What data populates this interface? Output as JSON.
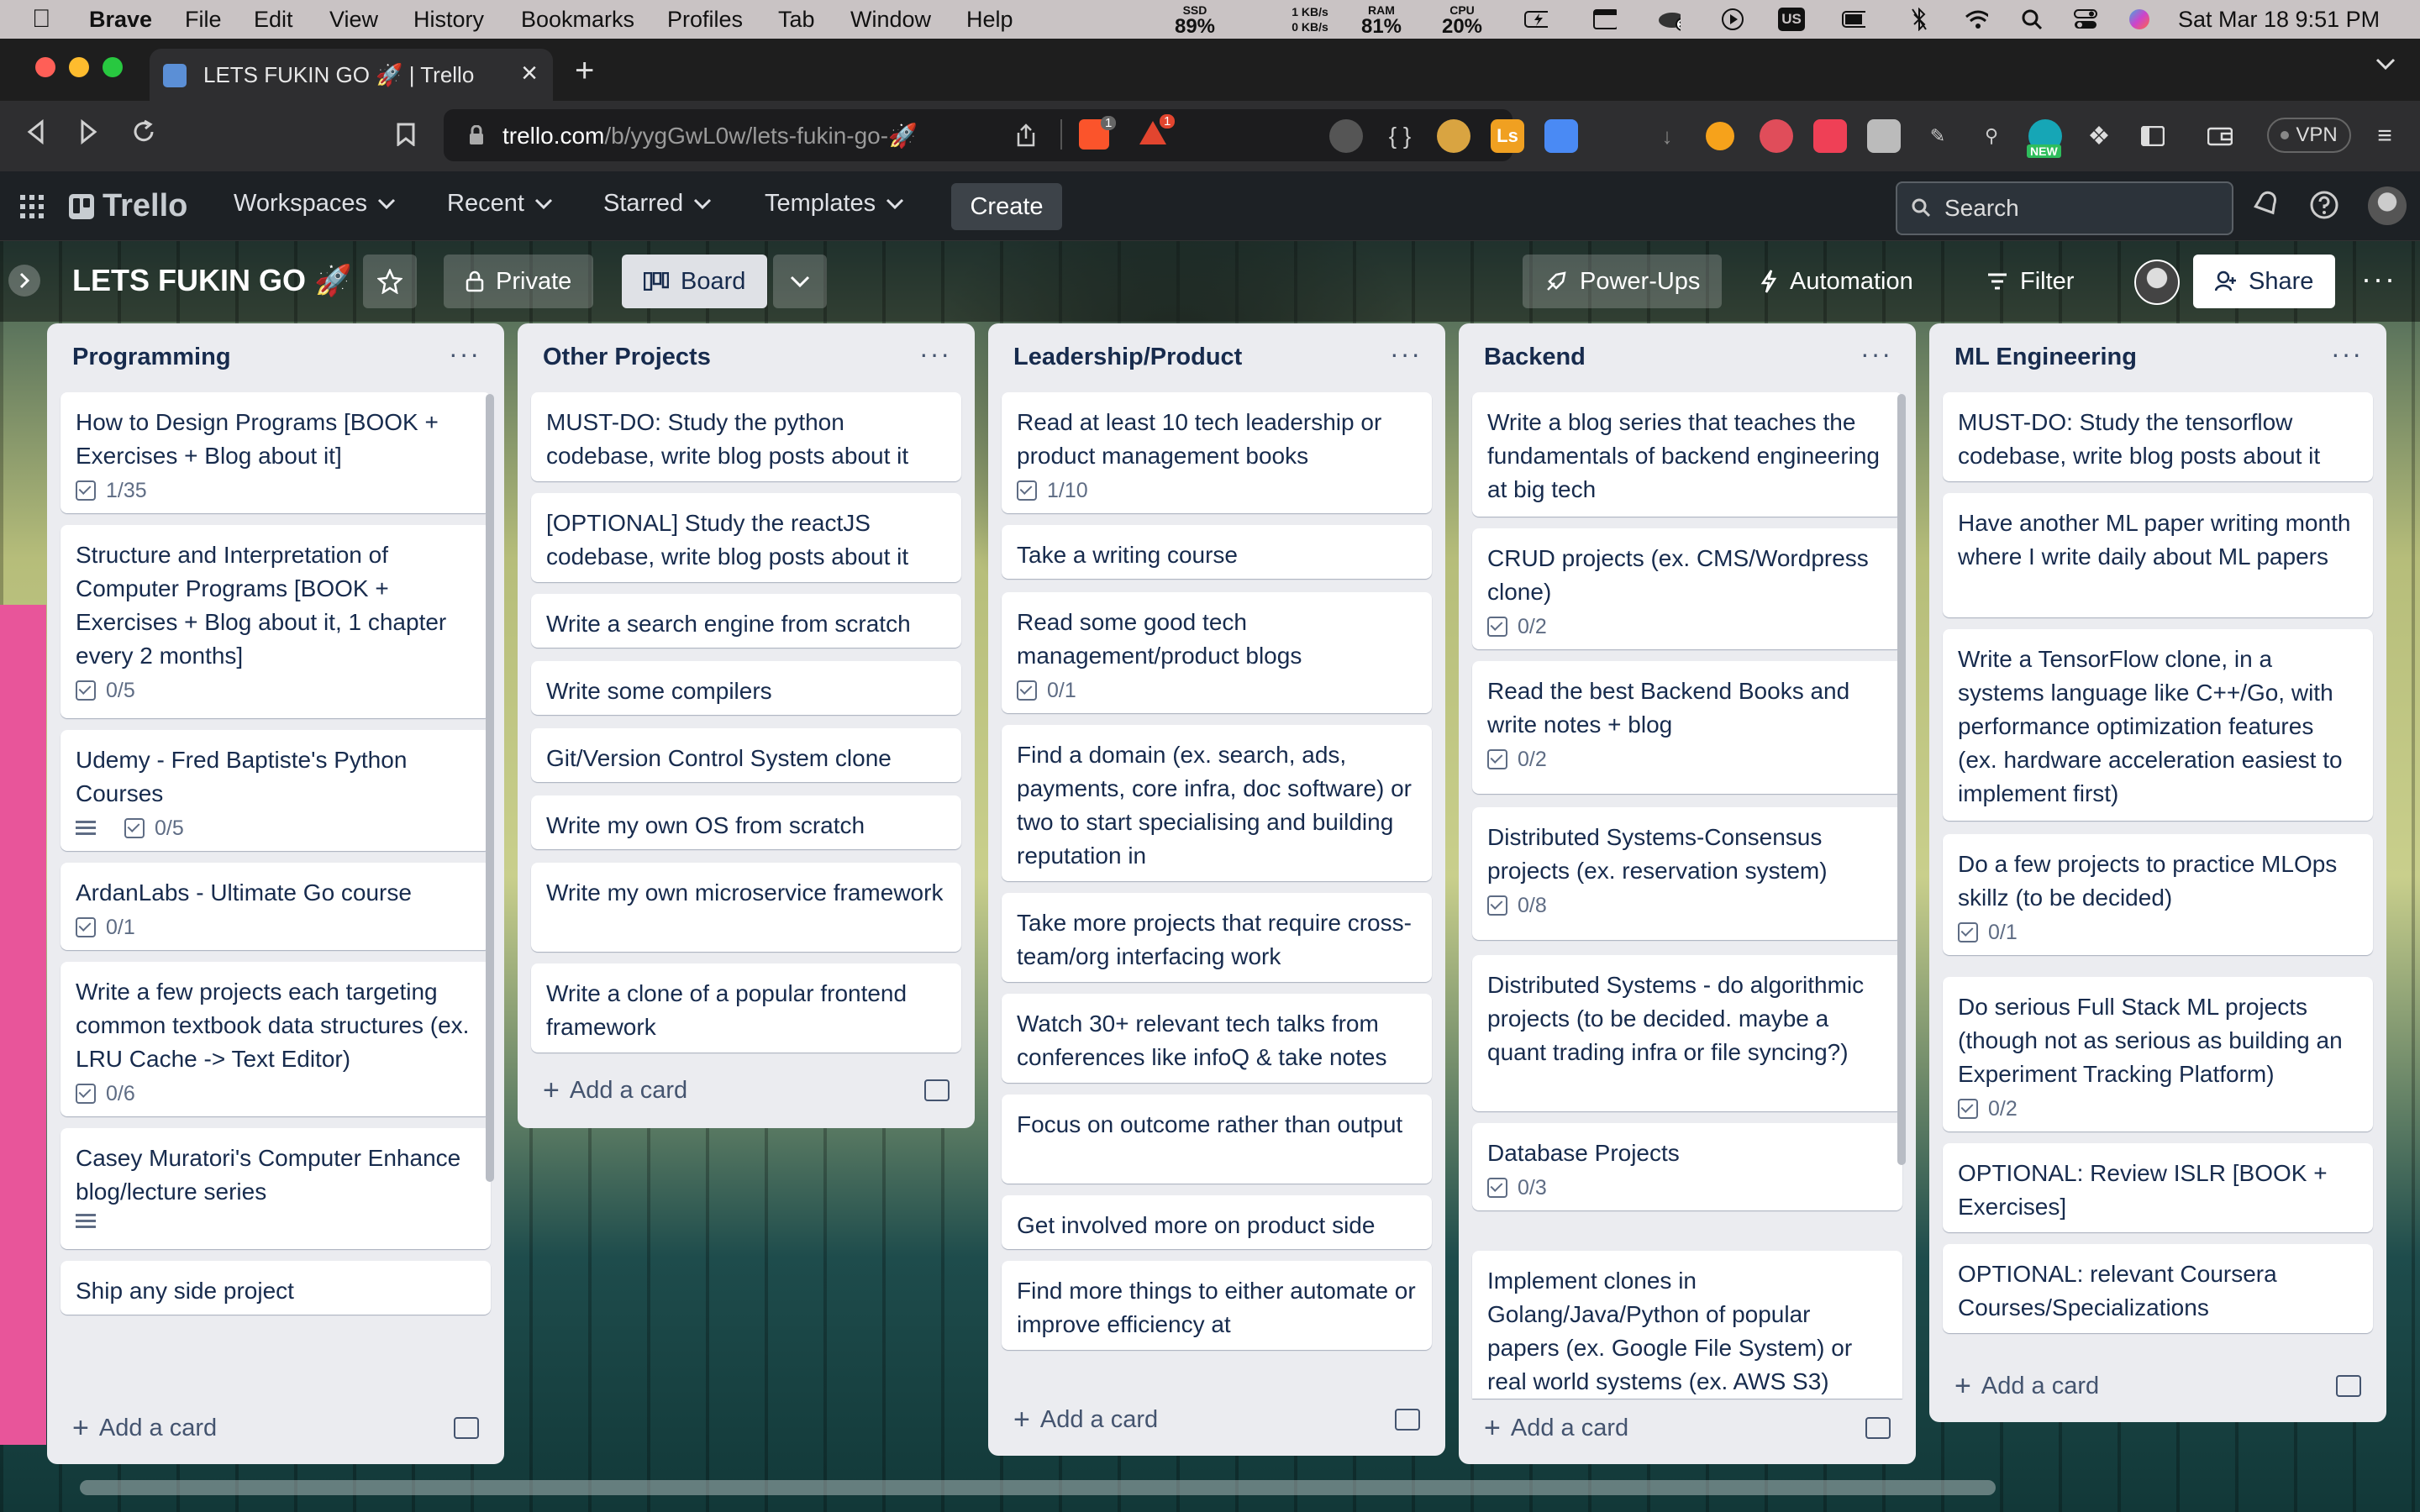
{
  "menubar": {
    "app": "Brave",
    "items": [
      "File",
      "Edit",
      "View",
      "History",
      "Bookmarks",
      "Profiles",
      "Tab",
      "Window",
      "Help"
    ],
    "ssd_label": "SSD",
    "ssd_value": "89%",
    "net_up": "1 KB/s",
    "net_down": "0 KB/s",
    "ram_label": "RAM",
    "ram_value": "81%",
    "cpu_label": "CPU",
    "cpu_value": "20%",
    "input_source": "US",
    "clock": "Sat Mar 18  9:51 PM"
  },
  "browser": {
    "tab_title": "LETS FUKIN GO 🚀 | Trello",
    "url_domain": "trello.com",
    "url_path": "/b/yygGwL0w/lets-fukin-go-🚀",
    "brave_shield_count": "1",
    "rewards_count": "1",
    "vpn_label": "VPN",
    "ext_ls": "Ls",
    "ext_new": "NEW"
  },
  "trello": {
    "logo": "Trello",
    "nav": [
      "Workspaces",
      "Recent",
      "Starred",
      "Templates"
    ],
    "create": "Create",
    "search_placeholder": "Search"
  },
  "board": {
    "title": "LETS FUKIN GO 🚀",
    "visibility": "Private",
    "view": "Board",
    "power_ups": "Power-Ups",
    "automation": "Automation",
    "filter": "Filter",
    "share": "Share"
  },
  "add_card_label": "Add a card",
  "lists": [
    {
      "title": "Programming",
      "cards": [
        {
          "text": "How to Design Programs [BOOK + Exercises + Blog about it]",
          "checklist": "1/35"
        },
        {
          "text": "Structure and Interpretation of Computer Programs [BOOK + Exercises + Blog about it, 1 chapter every 2 months]",
          "checklist": "0/5"
        },
        {
          "text": "Udemy - Fred Baptiste's Python Courses",
          "checklist": "0/5",
          "description": true
        },
        {
          "text": "ArdanLabs - Ultimate Go course",
          "checklist": "0/1"
        },
        {
          "text": "Write a few projects each targeting common textbook data structures (ex. LRU Cache -> Text Editor)",
          "checklist": "0/6"
        },
        {
          "text": "Casey Muratori's Computer Enhance blog/lecture series",
          "description": true
        },
        {
          "text": "Ship any side project"
        }
      ]
    },
    {
      "title": "Other Projects",
      "cards": [
        {
          "text": "MUST-DO: Study the python codebase, write blog posts about it"
        },
        {
          "text": "[OPTIONAL] Study the reactJS codebase, write blog posts about it"
        },
        {
          "text": "Write a search engine from scratch"
        },
        {
          "text": "Write some compilers"
        },
        {
          "text": "Git/Version Control System clone"
        },
        {
          "text": "Write my own OS from scratch"
        },
        {
          "text": "Write my own microservice framework"
        },
        {
          "text": "Write a clone of a popular frontend framework"
        }
      ]
    },
    {
      "title": "Leadership/Product",
      "cards": [
        {
          "text": "Read at least 10 tech leadership or product management books",
          "checklist": "1/10"
        },
        {
          "text": "Take a writing course"
        },
        {
          "text": "Read some good tech management/product blogs",
          "checklist": "0/1"
        },
        {
          "text": "Find a domain (ex. search, ads, payments, core infra, doc software) or two to start specialising and building reputation in"
        },
        {
          "text": "Take more projects that require cross-team/org interfacing work"
        },
        {
          "text": "Watch 30+ relevant tech talks from conferences like infoQ & take notes"
        },
        {
          "text": "Focus on outcome rather than output"
        },
        {
          "text": "Get involved more on product side"
        },
        {
          "text": "Find more things to either automate or improve efficiency at"
        }
      ]
    },
    {
      "title": "Backend",
      "cards": [
        {
          "text": "Write a blog series that teaches the fundamentals of backend engineering at big tech"
        },
        {
          "text": "CRUD projects (ex. CMS/Wordpress clone)",
          "checklist": "0/2"
        },
        {
          "text": "Read the best Backend Books and write notes + blog",
          "checklist": "0/2"
        },
        {
          "text": "Distributed Systems-Consensus projects (ex. reservation system)",
          "checklist": "0/8"
        },
        {
          "text": "Distributed Systems - do algorithmic projects (to be decided. maybe a quant trading infra or file syncing?)"
        },
        {
          "text": "Database Projects",
          "checklist": "0/3"
        },
        {
          "text": "Implement clones in Golang/Java/Python of popular papers (ex. Google File System) or real world systems (ex. AWS S3)"
        }
      ]
    },
    {
      "title": "ML Engineering",
      "cards": [
        {
          "text": "MUST-DO: Study the tensorflow codebase, write blog posts about it"
        },
        {
          "text": "Have another ML paper writing month where I write daily about ML papers"
        },
        {
          "text": "Write a TensorFlow clone, in a systems language like C++/Go, with performance optimization features (ex. hardware acceleration easiest to implement first)"
        },
        {
          "text": "Do a few projects to practice MLOps skillz (to be decided)",
          "checklist": "0/1"
        },
        {
          "text": "Do serious Full Stack ML projects (though not as serious as building an Experiment Tracking Platform)",
          "checklist": "0/2"
        },
        {
          "text": "OPTIONAL: Review ISLR [BOOK + Exercises]"
        },
        {
          "text": "OPTIONAL: relevant Coursera Courses/Specializations"
        }
      ]
    }
  ]
}
